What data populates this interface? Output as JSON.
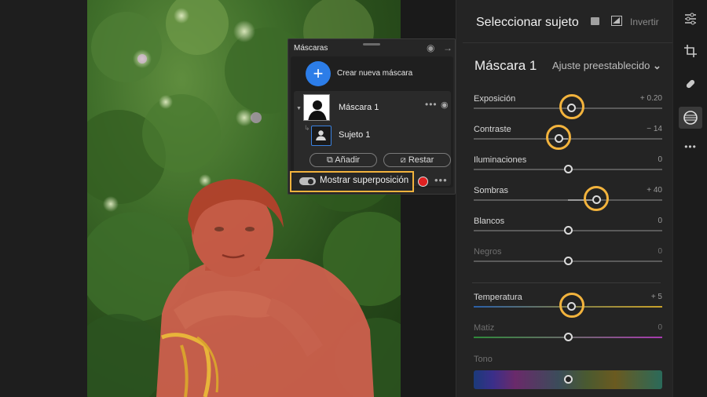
{
  "masks_panel": {
    "title": "Máscaras",
    "new_mask_label": "Crear nueva máscara",
    "new_mask_icon": "+",
    "mask_name": "Máscara 1",
    "subject_name": "Sujeto 1",
    "add_button": "Añadir",
    "subtract_button": "Restar",
    "overlay_label": "Mostrar superposición",
    "overlay_color": "#e02121"
  },
  "right_panel": {
    "title": "Seleccionar sujeto",
    "invert_label": "Invertir",
    "mask_name": "Máscara 1",
    "preset_label": "Ajuste preestablecido",
    "preset_chevron": "⌄"
  },
  "sliders": [
    {
      "label": "Exposición",
      "value": "+ 0.20",
      "position": 0.52,
      "highlight": true,
      "dim": false
    },
    {
      "label": "Contraste",
      "value": "− 14",
      "position": 0.45,
      "highlight": true,
      "dim": false
    },
    {
      "label": "Iluminaciones",
      "value": "0",
      "position": 0.5,
      "highlight": false,
      "dim": false
    },
    {
      "label": "Sombras",
      "value": "+ 40",
      "position": 0.65,
      "highlight": true,
      "dim": false
    },
    {
      "label": "Blancos",
      "value": "0",
      "position": 0.5,
      "highlight": false,
      "dim": false
    },
    {
      "label": "Negros",
      "value": "0",
      "position": 0.5,
      "highlight": false,
      "dim": true
    },
    {
      "label": "Temperatura",
      "value": "+ 5",
      "position": 0.52,
      "highlight": true,
      "dim": false
    },
    {
      "label": "Matiz",
      "value": "0",
      "position": 0.5,
      "highlight": false,
      "dim": true
    },
    {
      "label": "Tono",
      "value": "",
      "position": 0.5,
      "highlight": false,
      "dim": true
    }
  ],
  "toolbar": {
    "tools": [
      "sliders-icon",
      "crop-icon",
      "healing-icon",
      "masking-icon",
      "more-icon"
    ],
    "more": "•••"
  },
  "colors": {
    "accent": "#2c7de8",
    "highlight": "#f2b33d",
    "overlay": "#e02121"
  }
}
